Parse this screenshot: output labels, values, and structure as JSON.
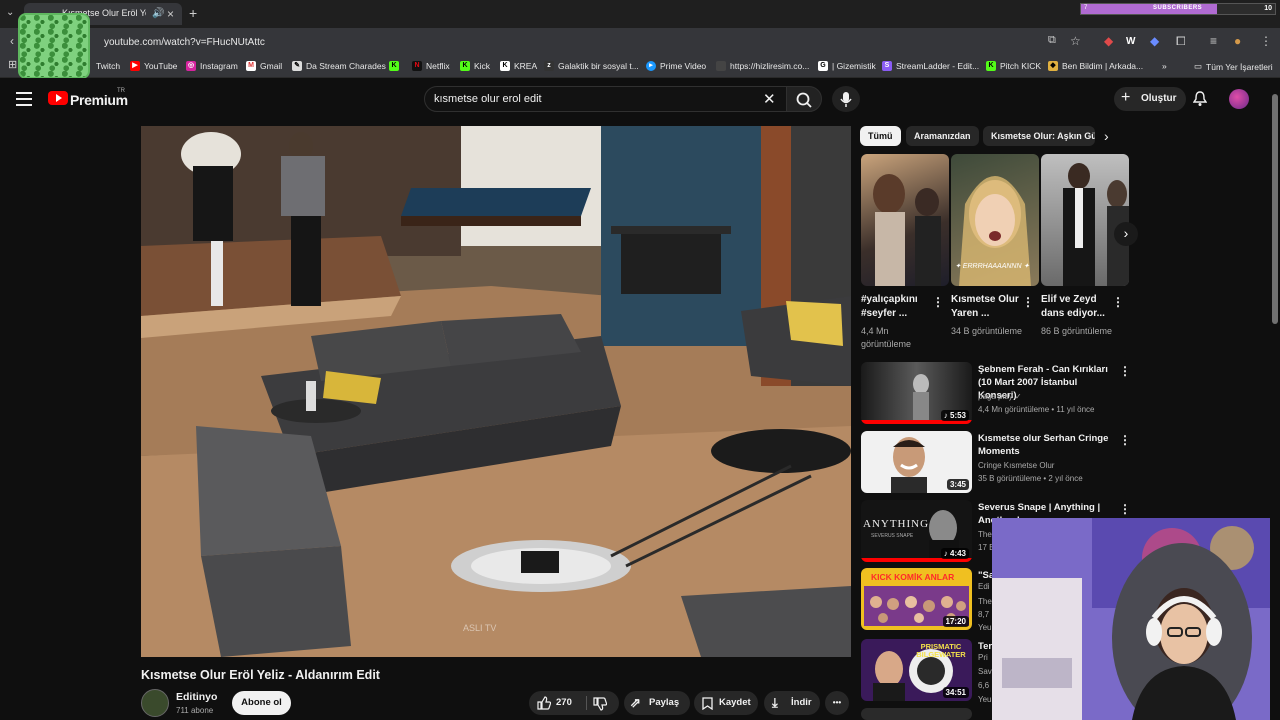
{
  "browser": {
    "tab_title": "Kısmetse Olur Eröl Yeliz - Al",
    "url": "youtube.com/watch?v=FHucNUtAttc",
    "subscriber_goal": {
      "label": "SUBSCRIBERS",
      "current": "7",
      "target": "10",
      "progress": 0.7
    },
    "bookmarks": [
      {
        "label": "Twitch",
        "icon": "twitch-icon"
      },
      {
        "label": "YouTube",
        "icon": "youtube-icon"
      },
      {
        "label": "Instagram",
        "icon": "instagram-icon"
      },
      {
        "label": "Gmail",
        "icon": "gmail-icon"
      },
      {
        "label": "Da Stream Charades",
        "icon": "game-icon"
      },
      {
        "label": "",
        "icon": "kick-icon"
      },
      {
        "label": "Netflix",
        "icon": "netflix-icon"
      },
      {
        "label": "Kick",
        "icon": "kick-icon"
      },
      {
        "label": "KREA",
        "icon": "krea-icon"
      },
      {
        "label": "Galaktik bir sosyal t...",
        "icon": "zk-icon"
      },
      {
        "label": "Prime Video",
        "icon": "prime-icon"
      },
      {
        "label": "https://hizliresim.co...",
        "icon": "hizliresim-icon"
      },
      {
        "label": "| Gizemistik",
        "icon": "google-icon"
      },
      {
        "label": "StreamLadder - Edit...",
        "icon": "streamladder-icon"
      },
      {
        "label": "Pitch KICK",
        "icon": "kick-icon"
      },
      {
        "label": "Ben Bildim | Arkada...",
        "icon": "benbildim-icon"
      }
    ],
    "all_bookmarks": "Tüm Yer İşaretleri",
    "more_bookmarks": "»"
  },
  "youtube": {
    "brand": "Premium",
    "region": "TR",
    "search_query": "kısmetse olur erol edit",
    "create_label": "Oluştur"
  },
  "video": {
    "title": "Kısmetse Olur Eröl Yeliz - Aldanırım Edit",
    "channel": "Editinyo",
    "subscribers": "711 abone",
    "subscribe_label": "Abone ol",
    "likes": "270",
    "share_label": "Paylaş",
    "save_label": "Kaydet",
    "download_label": "İndir",
    "more_label": "•••",
    "watermark": "ASLI TV"
  },
  "chips": [
    "Tümü",
    "Aramanızdan",
    "Kısmetse Olur: Aşkın Gücü"
  ],
  "shorts": [
    {
      "title": "#yalıçapkını #seyfer ...",
      "views": "4,4 Mn görüntüleme",
      "overlay": ""
    },
    {
      "title": "Kısmetse Olur Yaren ...",
      "views": "34 B görüntüleme",
      "overlay": "✦ ERRRHAAAANNN ✦"
    },
    {
      "title": "Elif ve Zeyd dans ediyor...",
      "views": "86 B görüntüleme",
      "overlay": ""
    }
  ],
  "recommended": [
    {
      "title": "Şebnem Ferah - Can Kırıkları (10 Mart 2007 İstanbul Konseri)",
      "channel": "paga play ✓",
      "meta": "4,4 Mn görüntüleme • 11 yıl önce",
      "duration": "♪ 5:53"
    },
    {
      "title": "Kısmetse olur Serhan Cringe Moments",
      "channel": "Cringe Kısmetse Olur",
      "meta": "35 B görüntüleme • 2 yıl önce",
      "duration": "3:45"
    },
    {
      "title": "Severus Snape | Anything | Another Love",
      "channel": "The",
      "meta": "17 B",
      "duration": "♪ 4:43",
      "thumb_text": "ANYTHING",
      "thumb_sub": "SEVERUS SNAPE"
    },
    {
      "title": "\"Sa",
      "channel": "Edi",
      "meta": "The",
      "extra": "8,7",
      "extra2": "Yeu",
      "duration": "17:20",
      "thumb_text": "KICK KOMİK ANLAR"
    },
    {
      "title": "Ter",
      "channel": "Pri",
      "meta": "Sav",
      "extra": "6,6",
      "extra2": "Yeu",
      "duration": "34:51",
      "thumb_text": "PRISMATIC BILGEWATER"
    }
  ],
  "colors": {
    "accent": "#ff0000",
    "background": "#0f0f0f",
    "subscriber_bar": "#b06bd2"
  }
}
